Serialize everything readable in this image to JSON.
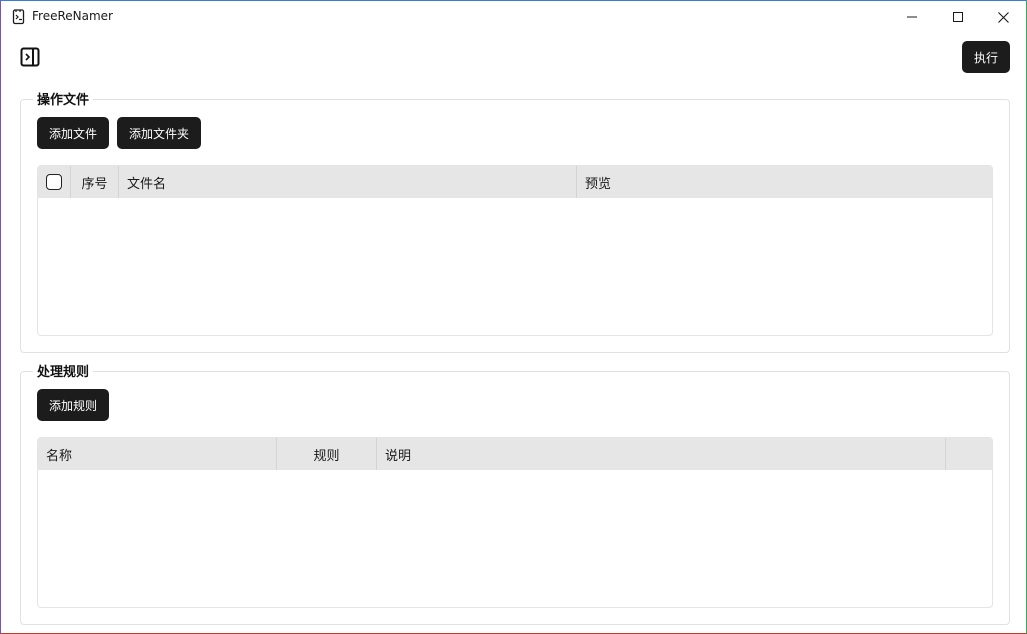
{
  "window": {
    "title": "FreeReNamer",
    "icon": "app-icon"
  },
  "toolbar": {
    "sidebar_icon": "sidebar-toggle-icon",
    "execute_label": "执行"
  },
  "files_group": {
    "legend": "操作文件",
    "add_file_label": "添加文件",
    "add_folder_label": "添加文件夹",
    "table": {
      "columns": [
        "",
        "序号",
        "文件名",
        "预览"
      ],
      "rows": []
    }
  },
  "rules_group": {
    "legend": "处理规则",
    "add_rule_label": "添加规则",
    "table": {
      "columns": [
        "名称",
        "规则",
        "说明",
        ""
      ],
      "rows": []
    }
  },
  "colors": {
    "button_bg": "#1c1c1c",
    "header_bg": "#e6e6e6"
  }
}
